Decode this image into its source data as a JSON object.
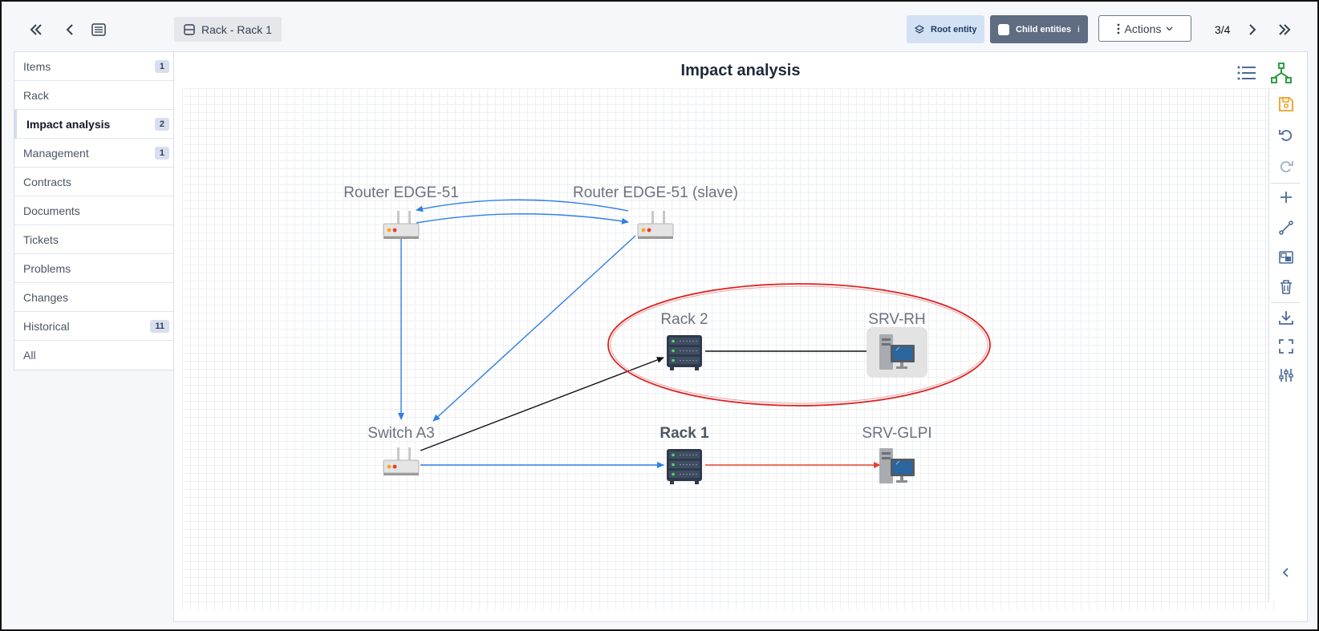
{
  "header": {
    "breadcrumb": "Rack - Rack 1",
    "root_entity": "Root entity",
    "child_entities": "Child entities",
    "child_info": "i",
    "actions": "Actions",
    "pager": "3/4"
  },
  "sidebar": {
    "items": [
      {
        "label": "Items",
        "badge": "1"
      },
      {
        "label": "Rack",
        "badge": ""
      },
      {
        "label": "Impact analysis",
        "badge": "2"
      },
      {
        "label": "Management",
        "badge": "1"
      },
      {
        "label": "Contracts",
        "badge": ""
      },
      {
        "label": "Documents",
        "badge": ""
      },
      {
        "label": "Tickets",
        "badge": ""
      },
      {
        "label": "Problems",
        "badge": ""
      },
      {
        "label": "Changes",
        "badge": ""
      },
      {
        "label": "Historical",
        "badge": "11"
      },
      {
        "label": "All",
        "badge": ""
      }
    ]
  },
  "main": {
    "title": "Impact analysis"
  },
  "graph": {
    "nodes": {
      "router1": "Router EDGE-51",
      "router2": "Router EDGE-51 (slave)",
      "rack2": "Rack 2",
      "srvrh": "SRV-RH",
      "switch": "Switch A3",
      "rack1": "Rack 1",
      "srvglpi": "SRV-GLPI"
    }
  },
  "colors": {
    "edge_blue": "#2f7fe8",
    "edge_black": "#111111",
    "edge_red": "#e8432f",
    "group_outline": "#e02020",
    "save_icon": "#f0a020",
    "tree_icon": "#2f9e44"
  }
}
